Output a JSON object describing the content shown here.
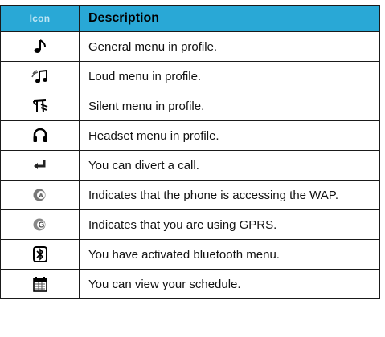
{
  "table": {
    "header": {
      "icon": "Icon",
      "description": "Description"
    },
    "rows": [
      {
        "icon": "note-icon",
        "description": "General menu in profile."
      },
      {
        "icon": "loud-note-icon",
        "description": "Loud menu in profile."
      },
      {
        "icon": "silent-icon",
        "description": "Silent menu in profile."
      },
      {
        "icon": "headset-icon",
        "description": "Headset menu in profile."
      },
      {
        "icon": "divert-call-icon",
        "description": "You can divert a call."
      },
      {
        "icon": "wap-icon",
        "description": "Indicates that the phone is accessing the WAP."
      },
      {
        "icon": "gprs-icon",
        "description": "Indicates that you are using GPRS."
      },
      {
        "icon": "bluetooth-icon",
        "description": "You have activated bluetooth menu."
      },
      {
        "icon": "schedule-icon",
        "description": "You can view your schedule."
      }
    ]
  }
}
